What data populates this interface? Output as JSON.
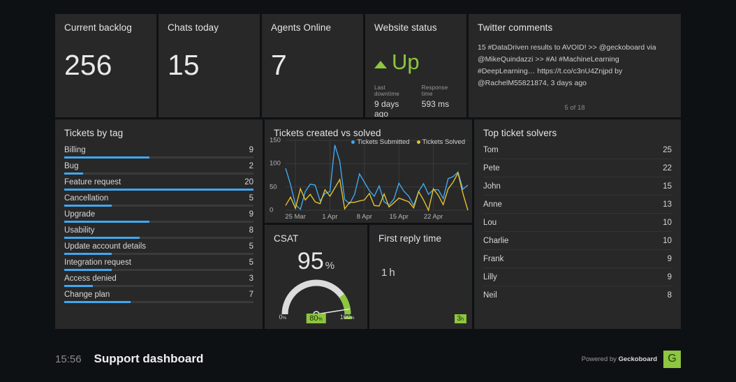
{
  "theme": {
    "page_bg": "#0e1114",
    "panel_bg": "#282828",
    "accent_blue": "#3fa8f0",
    "accent_green": "#8dc63f",
    "accent_yellow": "#e5c12e",
    "text": "#e6e6e6"
  },
  "kpis": [
    {
      "title": "Current backlog",
      "value": "256"
    },
    {
      "title": "Chats today",
      "value": "15"
    },
    {
      "title": "Agents Online",
      "value": "7"
    }
  ],
  "website_status": {
    "title": "Website status",
    "state": "Up",
    "trend_icon": "triangle-up-icon",
    "last_downtime_label": "Last downtime",
    "last_downtime_value": "9 days ago",
    "response_time_label": "Response time",
    "response_time_value": "593 ms"
  },
  "twitter": {
    "title": "Twitter comments",
    "text": "15 #DataDriven results to AVOID! >> @geckoboard via @MikeQuindazzi >> #AI #MachineLearning #DeepLearning… https://t.co/c3nU4Znjpd by @RachelM55821874, 3 days ago",
    "pagination": "5 of 18"
  },
  "tickets_by_tag": {
    "title": "Tickets by tag",
    "max": 20,
    "items": [
      {
        "label": "Billing",
        "value": 9
      },
      {
        "label": "Bug",
        "value": 2
      },
      {
        "label": "Feature request",
        "value": 20
      },
      {
        "label": "Cancellation",
        "value": 5
      },
      {
        "label": "Upgrade",
        "value": 9
      },
      {
        "label": "Usability",
        "value": 8
      },
      {
        "label": "Update account details",
        "value": 5
      },
      {
        "label": "Integration request",
        "value": 5
      },
      {
        "label": "Access denied",
        "value": 3
      },
      {
        "label": "Change plan",
        "value": 7
      }
    ]
  },
  "chart_data": {
    "type": "line",
    "title": "Tickets created vs solved",
    "xlabel": "",
    "ylabel": "",
    "ylim": [
      0,
      150
    ],
    "yticks": [
      0,
      50,
      100,
      150
    ],
    "grid": true,
    "legend_position": "top-right",
    "x_tick_labels": [
      "25 Mar",
      "1 Apr",
      "8 Apr",
      "15 Apr",
      "22 Apr"
    ],
    "x_tick_indices": [
      2,
      9,
      16,
      23,
      30
    ],
    "series": [
      {
        "name": "Tickets Submitted",
        "color": "#3fa8f0",
        "values": [
          90,
          55,
          12,
          2,
          40,
          56,
          54,
          20,
          36,
          40,
          140,
          105,
          23,
          14,
          34,
          78,
          60,
          42,
          30,
          52,
          18,
          11,
          24,
          58,
          41,
          30,
          10,
          40,
          57,
          34,
          44,
          44,
          25,
          68,
          72,
          82,
          45,
          54
        ]
      },
      {
        "name": "Tickets Solved",
        "color": "#e5c12e",
        "values": [
          10,
          28,
          4,
          46,
          22,
          34,
          18,
          14,
          44,
          30,
          48,
          66,
          3,
          17,
          17,
          20,
          22,
          36,
          10,
          9,
          35,
          7,
          16,
          26,
          22,
          18,
          5,
          40,
          22,
          0,
          46,
          32,
          12,
          46,
          60,
          80,
          36,
          0
        ]
      }
    ]
  },
  "csat": {
    "title": "CSAT",
    "value": "95",
    "unit": "%",
    "min_label": "0",
    "min_unit": "%",
    "max_label": "100",
    "max_unit": "%",
    "goal": "80",
    "goal_unit": "%",
    "percent": 95,
    "goal_percent": 80
  },
  "first_reply_time": {
    "title": "First reply time",
    "value": "1",
    "unit": "h",
    "goal": "3",
    "goal_unit": "h"
  },
  "top_solvers": {
    "title": "Top ticket solvers",
    "rows": [
      {
        "name": "Tom",
        "value": "25"
      },
      {
        "name": "Pete",
        "value": "22"
      },
      {
        "name": "John",
        "value": "15"
      },
      {
        "name": "Anne",
        "value": "13"
      },
      {
        "name": "Lou",
        "value": "10"
      },
      {
        "name": "Charlie",
        "value": "10"
      },
      {
        "name": "Frank",
        "value": "9"
      },
      {
        "name": "Lilly",
        "value": "9"
      },
      {
        "name": "Neil",
        "value": "8"
      }
    ]
  },
  "footer": {
    "clock": "15:56",
    "title": "Support dashboard",
    "powered_prefix": "Powered by ",
    "powered_brand": "Geckoboard",
    "logo_letter": "G"
  }
}
